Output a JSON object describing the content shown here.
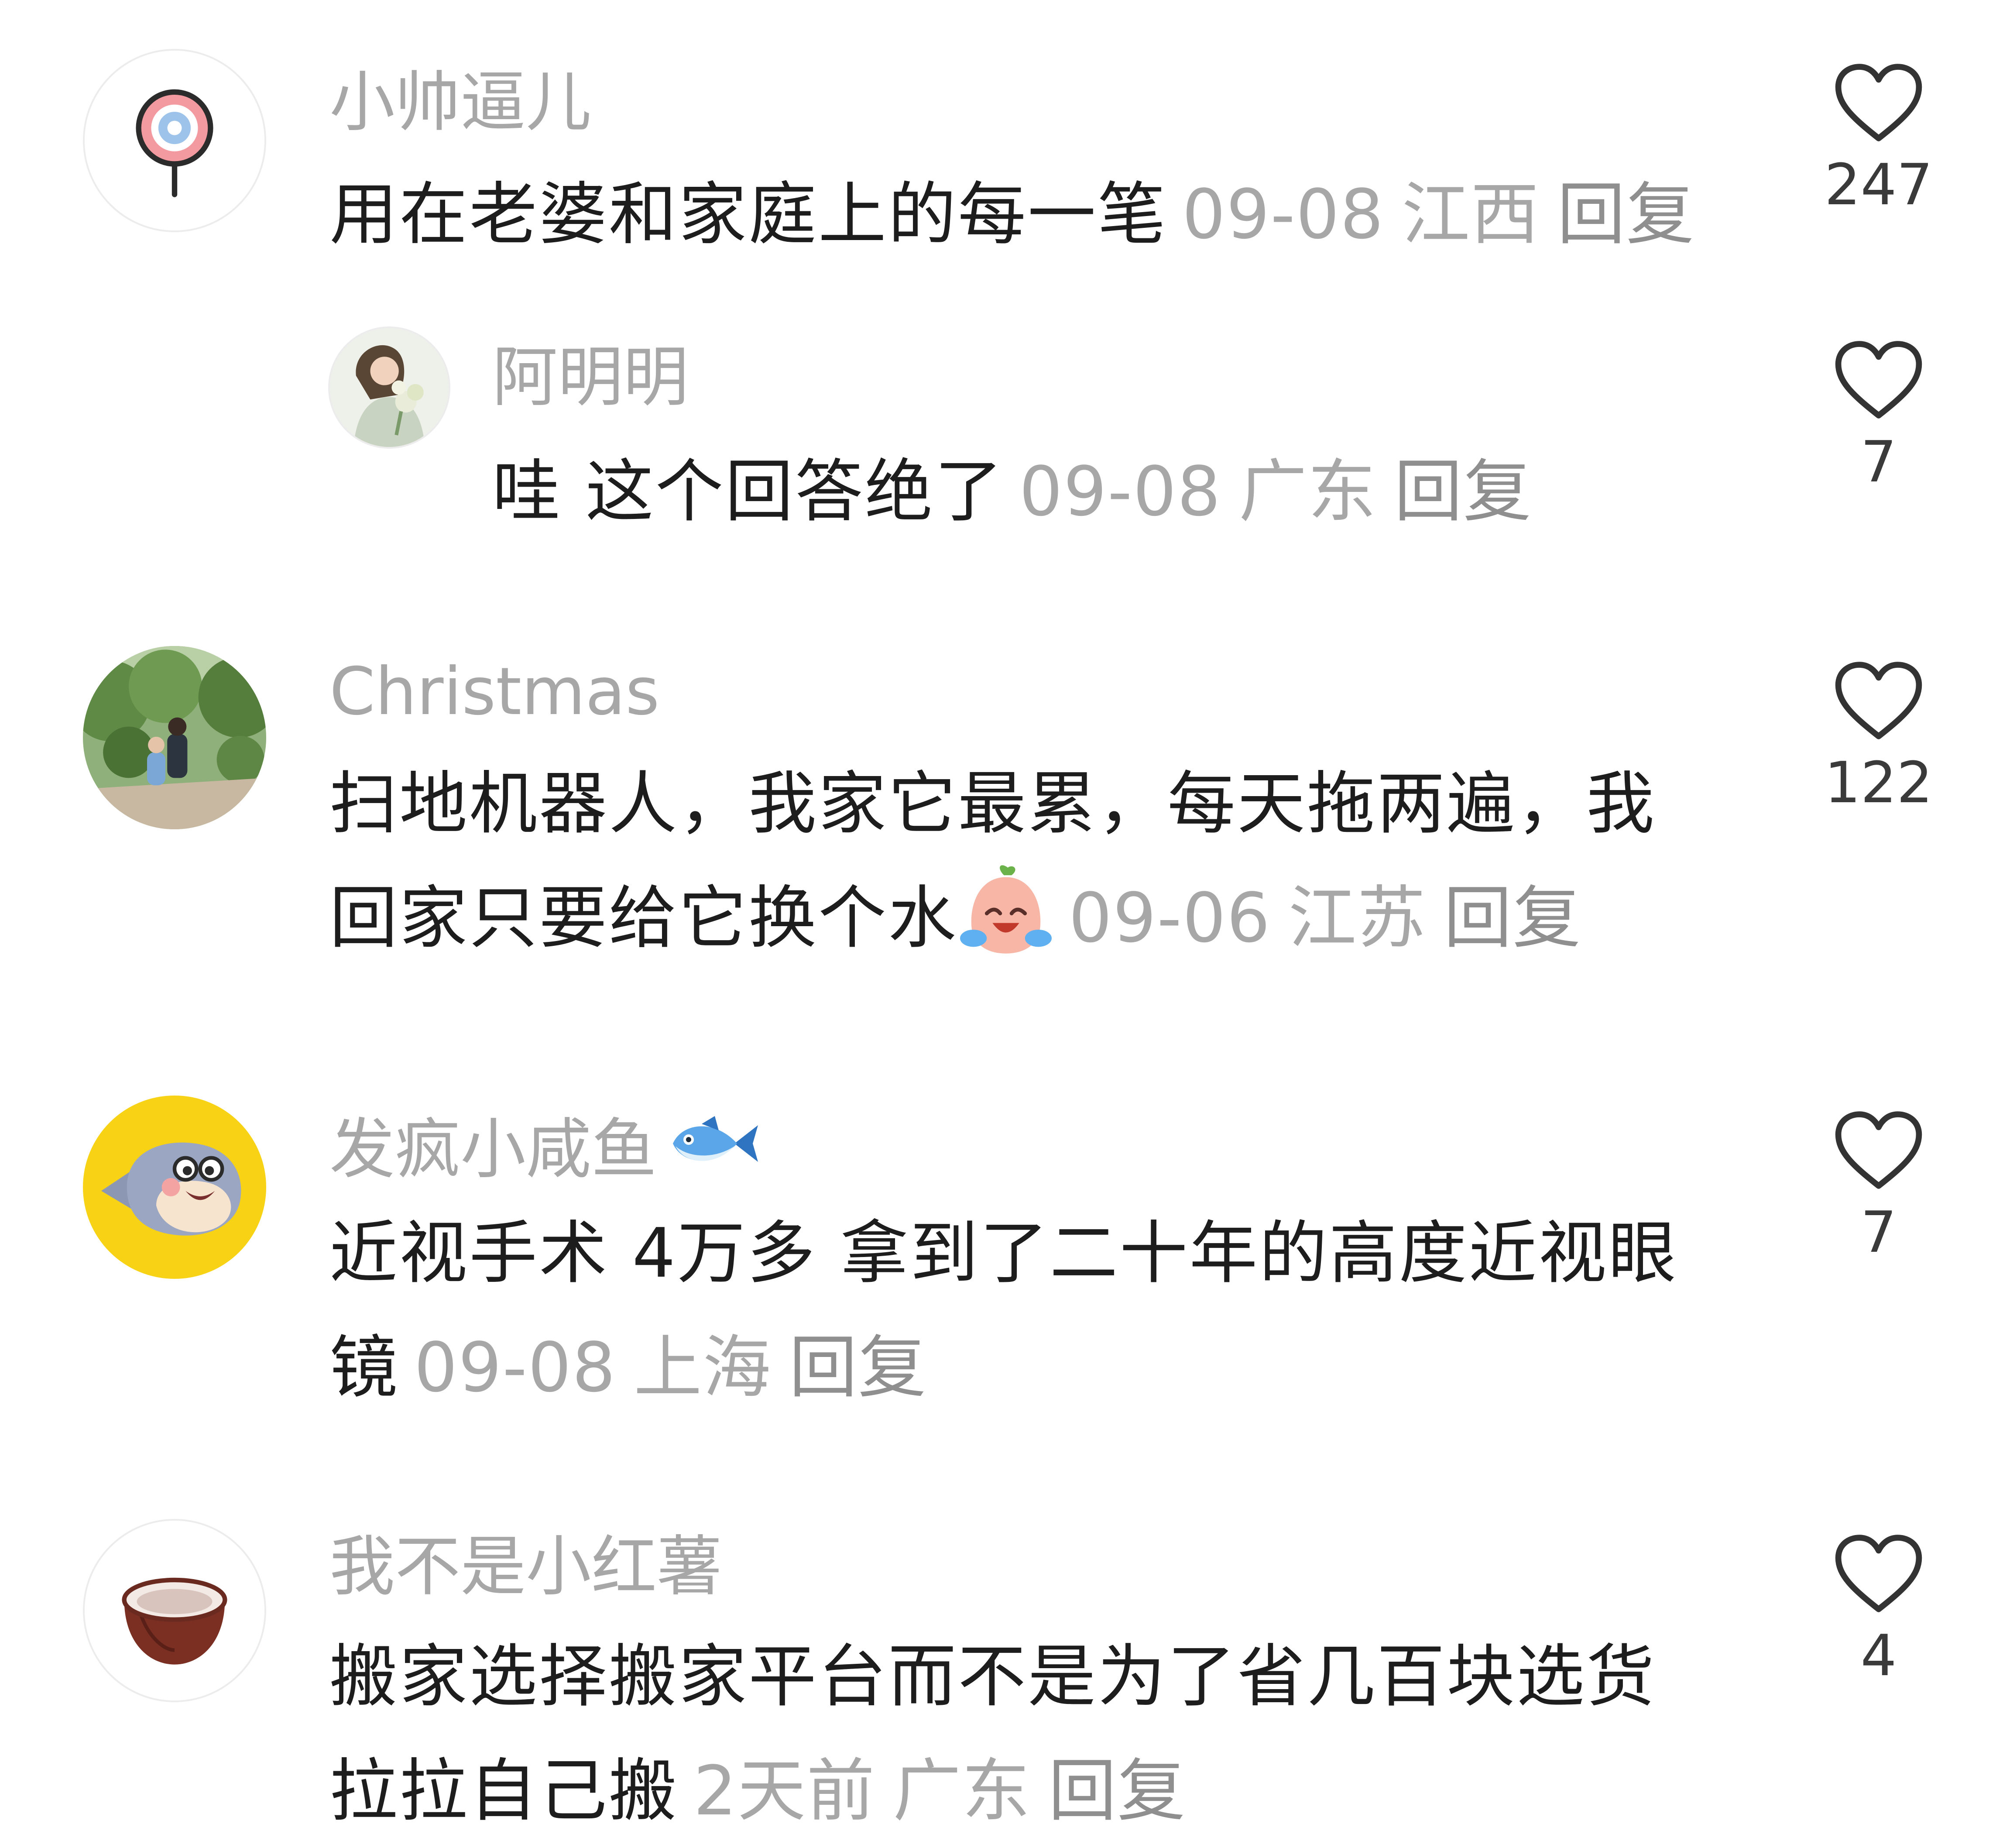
{
  "comments": [
    {
      "username": "小帅逼儿",
      "text": "用在老婆和家庭上的每一笔",
      "date": "09-08",
      "location": "江西",
      "reply_label": "回复",
      "likes": "247",
      "avatar_icon": "lollipop-icon"
    },
    {
      "username": "阿明明",
      "text": "哇 这个回答绝了",
      "date": "09-08",
      "location": "广东",
      "reply_label": "回复",
      "likes": "7",
      "avatar_icon": "woman-with-flowers-photo"
    },
    {
      "username": "Christmas",
      "text": "扫地机器人，我家它最累，每天拖两遍，我回家只要给它换个水",
      "emoji": "crying-laughing-emoji",
      "date": "09-06",
      "location": "江苏",
      "reply_label": "回复",
      "likes": "122",
      "avatar_icon": "garden-photo"
    },
    {
      "username": "发疯小咸鱼",
      "username_emoji": "fish-emoji",
      "text": "近视手术 4万多 拿到了二十年的高度近视眼镜",
      "date": "09-08",
      "location": "上海",
      "reply_label": "回复",
      "likes": "7",
      "avatar_icon": "cartoon-fish-icon"
    },
    {
      "username": "我不是小红薯",
      "text": "搬家选择搬家平台而不是为了省几百块选货拉拉自己搬",
      "date": "2天前",
      "location": "广东",
      "reply_label": "回复",
      "likes": "4",
      "avatar_icon": "coconut-bowl-icon"
    }
  ],
  "colors": {
    "username": "#a7a7a7",
    "comment_text": "#1d1d1d",
    "meta": "#a7a7a7",
    "like_count": "#3a3a3a",
    "heart_stroke": "#333333"
  }
}
